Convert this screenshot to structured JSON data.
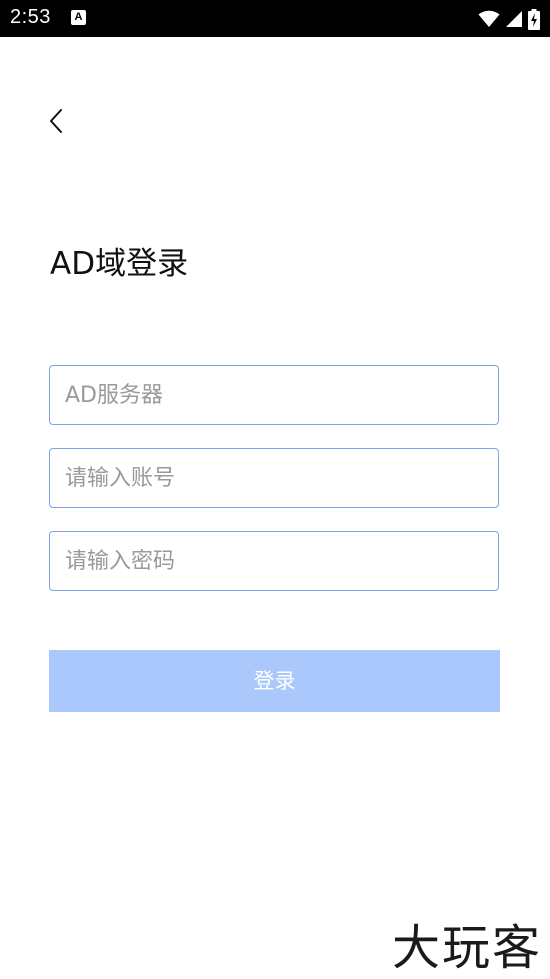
{
  "status_bar": {
    "time": "2:53",
    "app_icon_glyph": "A",
    "icons": [
      "wifi-icon",
      "cellular-signal-icon",
      "battery-charging-icon"
    ]
  },
  "header": {
    "back_icon": "chevron-left-icon"
  },
  "page": {
    "title": "AD域登录"
  },
  "form": {
    "server_placeholder": "AD服务器",
    "server_value": "",
    "account_placeholder": "请输入账号",
    "account_value": "",
    "password_placeholder": "请输入密码",
    "password_value": "",
    "login_label": "登录"
  },
  "colors": {
    "status_bar": "#000000",
    "field_border": "#7fa6e3",
    "button_bg": "#aac8fc",
    "button_text": "#ffffff",
    "placeholder": "#9a9a9a"
  },
  "watermark": {
    "text": "大玩客"
  }
}
